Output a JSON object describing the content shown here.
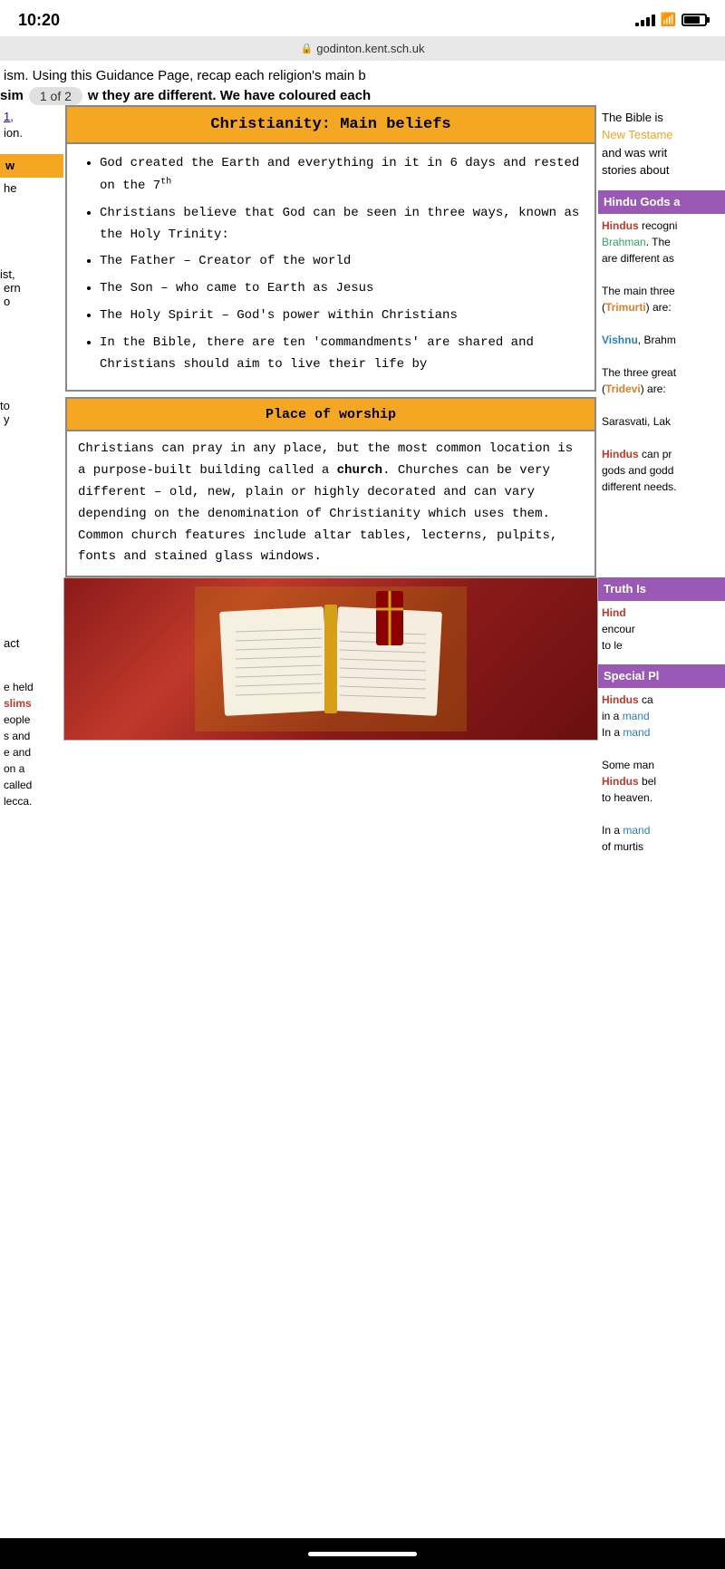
{
  "statusBar": {
    "time": "10:20",
    "url": "godinton.kent.sch.uk"
  },
  "pageBadge": "1 of 2",
  "introLine1": "ism. Using this Guidance Page, recap each religion's main b",
  "introLine2_pre": "sim",
  "introLine2_post": "w they are different. We have coloured each",
  "leftColumn": {
    "link": "1,",
    "ion": "ion.",
    "w": "w",
    "he": "he",
    "ist": "ist,",
    "ern": "ern",
    "o": "o",
    "to": "to",
    "y": "y"
  },
  "christianity": {
    "header": "Christianity: Main beliefs",
    "beliefs": [
      "God created the Earth and everything in it in 6 days and rested on the 7th",
      "Christians believe that God can be seen in three ways, known as the Holy Trinity:",
      "The Father – Creator of the world",
      "The Son – who came to Earth as Jesus",
      "The Holy Spirit – God's power within Christians",
      "In the Bible, there are ten 'commandments' are shared and Christians should aim to live their life by"
    ]
  },
  "placeOfWorship": {
    "header": "Place of worship",
    "body": "Christians can pray in any place, but the most common location is a purpose-built building called a church. Churches can be very different – old, new, plain or highly decorated and can vary depending on the denomination of Christianity which uses them. Common church features include altar tables, lecterns, pulpits, fonts and stained glass windows."
  },
  "rightColumn": {
    "bibleText1": "The Bible is",
    "bibleText2": "New Testame",
    "bibleText3": "and was writ",
    "bibleText4": "stories about",
    "hinduGodsHeader": "Hindu Gods a",
    "hinduBody1": "Hindus recogni",
    "hinduBody2": "Brahman. The",
    "hinduBody3": "are different as",
    "hinduBody4": "The main three",
    "hinduBody5": "(Trimurti) are:",
    "hinduBody6": "Vishnu, Brahm",
    "hinduBody7": "The three great",
    "hinduBody8": "(Tridevi) are:",
    "hinduBody9": "Sarasvati, Lak",
    "hinduBody10": "Hindus can pr",
    "hinduBody11": "gods and godd",
    "hinduBody12": "different needs."
  },
  "bottomRight": {
    "truthHeader": "Truth Is",
    "truthBody1": "Hind",
    "truthBody2": "encour",
    "truthBody3": "to le",
    "specialHeader": "Special Pl",
    "specialBody1": "Hindus ca",
    "specialBody2": "in a mand",
    "specialBody3": "In a mand",
    "specialBody4": "Some man",
    "specialBody5": "Hindus bel",
    "specialBody6": "to heaven.",
    "specialBody7": "In a mand",
    "specialBody8": "of murtis"
  },
  "bottomLeft": {
    "act": "act",
    "held": "e held",
    "slims": "slims",
    "eople": "eople",
    "sand": "s and",
    "eand": "e and",
    "ona": "on a",
    "called": "called",
    "lecca": "lecca."
  }
}
